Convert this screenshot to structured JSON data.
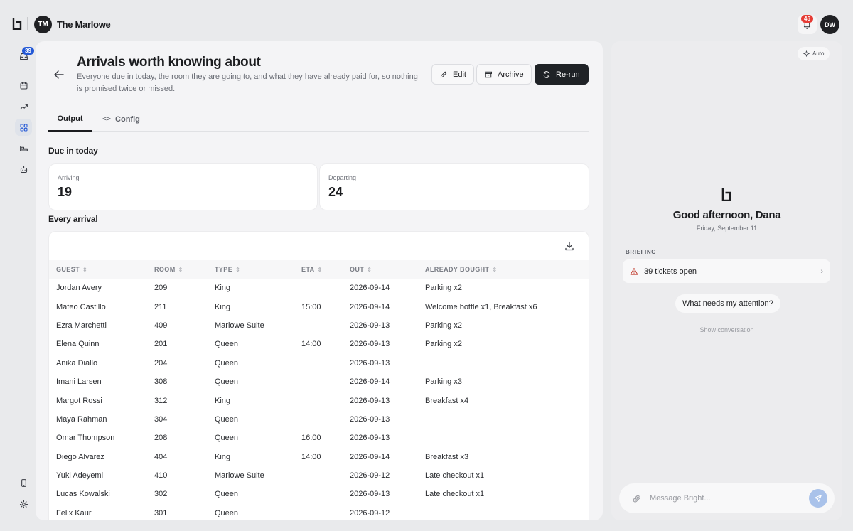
{
  "header": {
    "workspace_initials": "TM",
    "workspace_name": "The Marlowe",
    "notifications_count": "46",
    "user_initials": "DW"
  },
  "rail": {
    "inbox_badge": "39",
    "items": [
      "inbox-icon",
      "calendar-icon",
      "trend-icon",
      "grid-icon",
      "bed-icon",
      "robot-icon",
      "phone-icon",
      "settings-icon"
    ]
  },
  "page": {
    "title": "Arrivals worth knowing about",
    "description": "Everyone due in today, the room they are going to, and what they have already paid for, so nothing is promised twice or missed.",
    "actions": {
      "edit": "Edit",
      "archive": "Archive",
      "rerun": "Re-run"
    },
    "tabs": {
      "output": "Output",
      "config": "Config"
    }
  },
  "summary": {
    "heading": "Due in today",
    "arriving_label": "Arriving",
    "arriving_value": "19",
    "departing_label": "Departing",
    "departing_value": "24"
  },
  "arrivals": {
    "heading": "Every arrival",
    "columns": [
      "GUEST",
      "ROOM",
      "TYPE",
      "ETA",
      "OUT",
      "ALREADY BOUGHT"
    ],
    "rows": [
      [
        "Jordan Avery",
        "209",
        "King",
        "",
        "2026-09-14",
        "Parking x2"
      ],
      [
        "Mateo Castillo",
        "211",
        "King",
        "15:00",
        "2026-09-14",
        "Welcome bottle x1, Breakfast x6"
      ],
      [
        "Ezra Marchetti",
        "409",
        "Marlowe Suite",
        "",
        "2026-09-13",
        "Parking x2"
      ],
      [
        "Elena Quinn",
        "201",
        "Queen",
        "14:00",
        "2026-09-13",
        "Parking x2"
      ],
      [
        "Anika Diallo",
        "204",
        "Queen",
        "",
        "2026-09-13",
        ""
      ],
      [
        "Imani Larsen",
        "308",
        "Queen",
        "",
        "2026-09-14",
        "Parking x3"
      ],
      [
        "Margot Rossi",
        "312",
        "King",
        "",
        "2026-09-13",
        "Breakfast x4"
      ],
      [
        "Maya Rahman",
        "304",
        "Queen",
        "",
        "2026-09-13",
        ""
      ],
      [
        "Omar Thompson",
        "208",
        "Queen",
        "16:00",
        "2026-09-13",
        ""
      ],
      [
        "Diego Alvarez",
        "404",
        "King",
        "14:00",
        "2026-09-14",
        "Breakfast x3"
      ],
      [
        "Yuki Adeyemi",
        "410",
        "Marlowe Suite",
        "",
        "2026-09-12",
        "Late checkout x1"
      ],
      [
        "Lucas Kowalski",
        "302",
        "Queen",
        "",
        "2026-09-13",
        "Late checkout x1"
      ],
      [
        "Felix Kaur",
        "301",
        "Queen",
        "",
        "2026-09-12",
        ""
      ]
    ]
  },
  "chat": {
    "mode": "Auto",
    "greeting": "Good afternoon, Dana",
    "date": "Friday, September 11",
    "briefing_heading": "BRIEFING",
    "briefing_item": "39 tickets open",
    "suggestion": "What needs my attention?",
    "show_conversation": "Show conversation",
    "composer_placeholder": "Message Bright..."
  },
  "colors": {
    "accent": "#2459d6",
    "alert": "#e53b34",
    "primary_button": "#1f2226",
    "send_button": "#a9c2ea"
  }
}
